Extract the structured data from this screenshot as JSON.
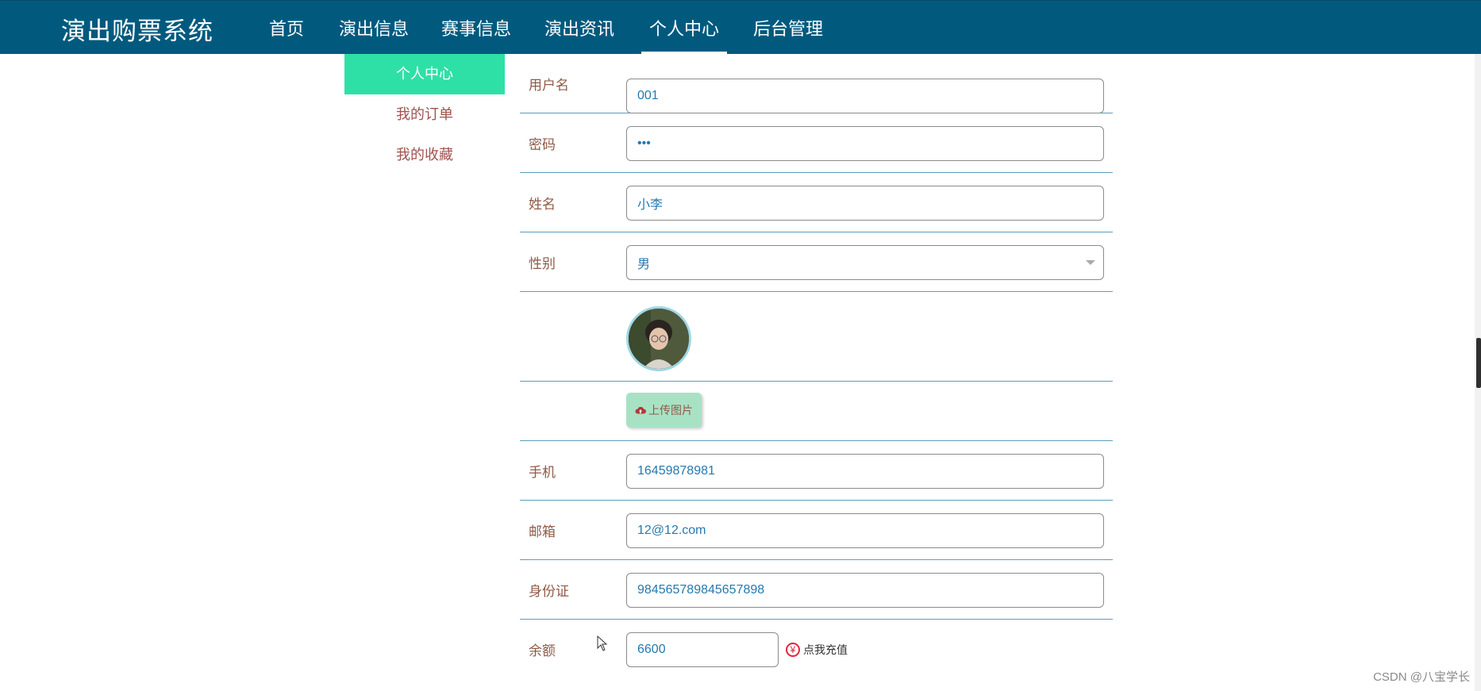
{
  "brand": "演出购票系统",
  "nav": [
    {
      "label": "首页"
    },
    {
      "label": "演出信息"
    },
    {
      "label": "赛事信息"
    },
    {
      "label": "演出资讯"
    },
    {
      "label": "个人中心",
      "active": true
    },
    {
      "label": "后台管理"
    }
  ],
  "side_menu": [
    {
      "label": "个人中心",
      "active": true
    },
    {
      "label": "我的订单"
    },
    {
      "label": "我的收藏"
    }
  ],
  "form": {
    "username": {
      "label": "用户名",
      "value": "001"
    },
    "password": {
      "label": "密码",
      "value": "•••"
    },
    "name": {
      "label": "姓名",
      "value": "小李"
    },
    "gender": {
      "label": "性别",
      "value": "男"
    },
    "upload_label": "上传图片",
    "phone": {
      "label": "手机",
      "value": "16459878981"
    },
    "email": {
      "label": "邮箱",
      "value": "12@12.com"
    },
    "id_card": {
      "label": "身份证",
      "value": "984565789845657898"
    },
    "balance": {
      "label": "余额",
      "value": "6600",
      "recharge_label": "点我充值",
      "currency_icon": "yen-icon"
    }
  },
  "watermark": "CSDN @八宝学长",
  "colors": {
    "topbar": "#015a7e",
    "side_active": "#2fe0a6",
    "label": "#8f5b48",
    "value": "#2479b0",
    "divider": "#5b9cbf"
  }
}
